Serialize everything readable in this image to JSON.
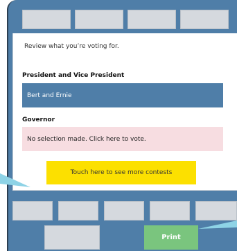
{
  "screen": {
    "intro": "Review what you’re voting for."
  },
  "contests": [
    {
      "title": "President and Vice President",
      "selection": "Bert and Ernie",
      "state": "selected"
    },
    {
      "title": "Governor",
      "selection": "No selection made. Click here to vote.",
      "state": "empty"
    }
  ],
  "more_contests_label": "Touch here to see more contests",
  "print_label": "Print",
  "colors": {
    "device_frame": "#4f7ea8",
    "selected_bg": "#4f7ea8",
    "empty_bg": "#f7dde1",
    "more_button": "#fce000",
    "print_button": "#7ac57e",
    "slot": "#d5d9de",
    "pointer": "#8ed3e6"
  }
}
